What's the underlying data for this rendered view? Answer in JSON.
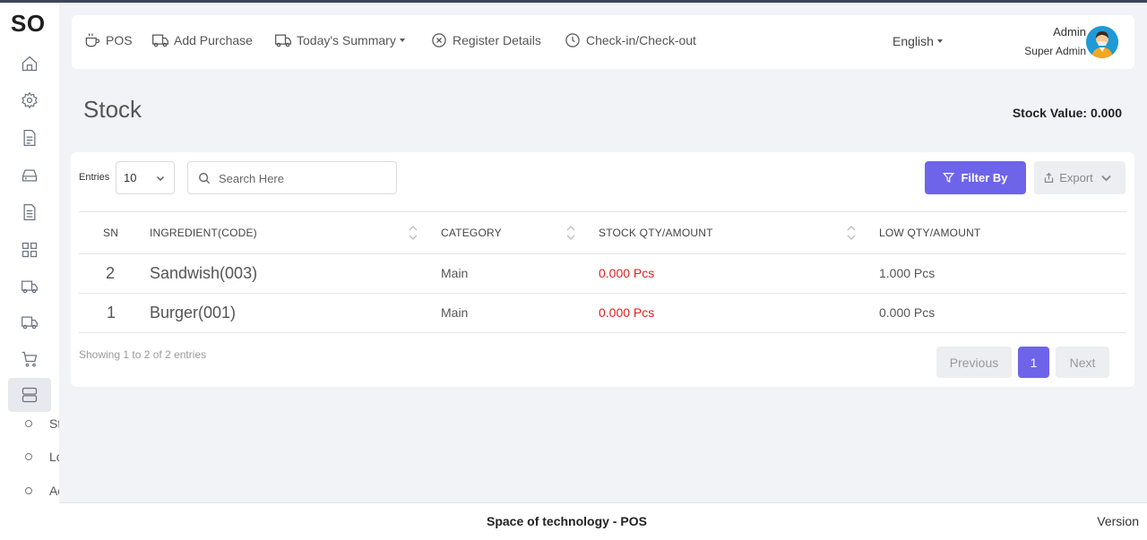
{
  "app": {
    "logo": "SO"
  },
  "sidebar": {
    "icons": [
      "home-icon",
      "gear-icon",
      "document-icon",
      "drive-icon",
      "file-text-icon",
      "grid-icon",
      "truck-icon",
      "truck-icon",
      "cart-icon",
      "server-icon"
    ],
    "sub_items": [
      "St",
      "Lo",
      "Ad"
    ]
  },
  "topnav": {
    "items": [
      {
        "label": "POS",
        "icon": "coffee-cup-icon"
      },
      {
        "label": "Add Purchase",
        "icon": "truck-icon"
      },
      {
        "label": "Today's Summary",
        "icon": "truck-icon"
      },
      {
        "label": "Register Details",
        "icon": "circle-x-icon"
      },
      {
        "label": "Check-in/Check-out",
        "icon": "clock-icon"
      }
    ],
    "language": "English",
    "user_name": "Admin",
    "user_role": "Super Admin"
  },
  "page": {
    "title": "Stock",
    "stock_value": "Stock Value: 0.000"
  },
  "toolbar": {
    "entries_label": "Entries",
    "entries_value": "10",
    "search_placeholder": "Search Here",
    "filter_label": "Filter By",
    "export_label": "Export"
  },
  "table": {
    "headers": [
      "SN",
      "INGREDIENT(CODE)",
      "CATEGORY",
      "STOCK QTY/AMOUNT",
      "LOW QTY/AMOUNT"
    ],
    "rows": [
      {
        "sn": "2",
        "ingredient": "Sandwish(003)",
        "category": "Main",
        "stock_qty": "0.000 Pcs",
        "low_qty": "1.000 Pcs"
      },
      {
        "sn": "1",
        "ingredient": "Burger(001)",
        "category": "Main",
        "stock_qty": "0.000 Pcs",
        "low_qty": "0.000 Pcs"
      }
    ]
  },
  "pagination": {
    "showing": "Showing 1 to 2 of 2 entries",
    "previous": "Previous",
    "current_page": "1",
    "next": "Next"
  },
  "footer": {
    "text": "Space of technology - POS",
    "version": "Version"
  },
  "colors": {
    "accent": "#6e64ea",
    "danger": "#e02020",
    "background": "#f2f3f6"
  }
}
